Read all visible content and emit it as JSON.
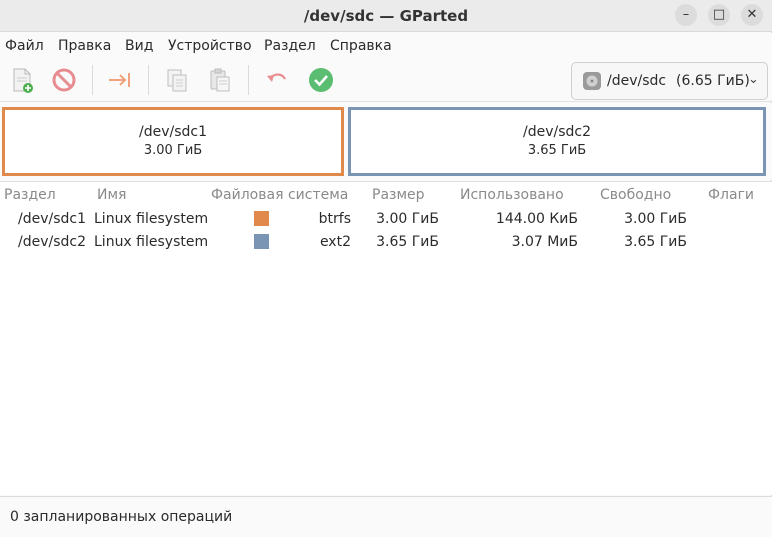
{
  "window": {
    "title": "/dev/sdc — GParted",
    "controls": {
      "minimize": "–",
      "maximize": "□",
      "close": "✕"
    }
  },
  "menu": [
    "Файл",
    "Правка",
    "Вид",
    "Устройство",
    "Раздел",
    "Справка"
  ],
  "toolbar": {
    "icons": [
      "new-partition-icon",
      "delete-partition-icon",
      "resize-move-icon",
      "copy-icon",
      "paste-icon",
      "undo-icon",
      "apply-icon"
    ],
    "device": {
      "name": "/dev/sdc",
      "size": "(6.65 ГиБ)"
    }
  },
  "partition_map": [
    {
      "name": "/dev/sdc1",
      "size": "3.00 ГиБ",
      "color": "#e0894a"
    },
    {
      "name": "/dev/sdc2",
      "size": "3.65 ГиБ",
      "color": "#7a95b3"
    }
  ],
  "table": {
    "headers": [
      "Раздел",
      "Имя",
      "Файловая система",
      "Размер",
      "Использовано",
      "Свободно",
      "Флаги"
    ],
    "rows": [
      {
        "partition": "/dev/sdc1",
        "name": "Linux filesystem",
        "fs_color": "#e0894a",
        "fs": "btrfs",
        "size": "3.00 ГиБ",
        "used": "144.00 КиБ",
        "free": "3.00 ГиБ",
        "flags": ""
      },
      {
        "partition": "/dev/sdc2",
        "name": "Linux filesystem",
        "fs_color": "#7a95b3",
        "fs": "ext2",
        "size": "3.65 ГиБ",
        "used": "3.07 МиБ",
        "free": "3.65 ГиБ",
        "flags": ""
      }
    ]
  },
  "status": "0 запланированных операций"
}
